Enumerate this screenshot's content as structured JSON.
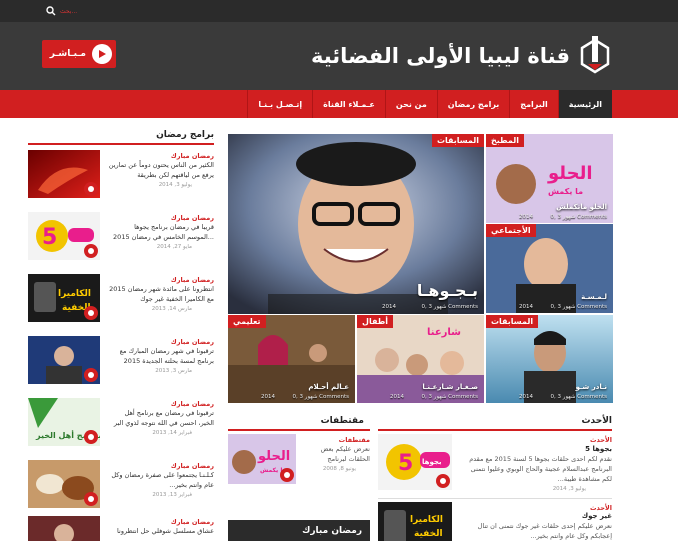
{
  "search": {
    "placeholder": "بحث..."
  },
  "header": {
    "live_label": "مـبـاشـر",
    "logo_text": "قناة ليبيا الأولى الفضائية"
  },
  "nav": {
    "items": [
      "الرئيسية",
      "البرامج",
      "برامج رمضان",
      "من نحن",
      "عـمـلاء القناة",
      "إتـصـل بـنـا"
    ]
  },
  "sidebar": {
    "title": "برامج رمضان",
    "items": [
      {
        "category": "رمضان مبارك",
        "title": "الكثير من الناس  يحتون دوماً عن تمارين يرفع من لياقتهم لكن بطريقة",
        "date": "يوليو 3, 2014"
      },
      {
        "category": "رمضان مبارك",
        "title": "قريبا في رمضان برنامج يجوها ...الموسم الخامس في رمضان 2015",
        "date": "مايو 27, 2014"
      },
      {
        "category": "رمضان مبارك",
        "title": "انتظرونا على مائدة شهر رمضان 2015 مع الكاميرا الخفية غير جوك",
        "date": "مارس 14, 2013"
      },
      {
        "category": "رمضان مبارك",
        "title": "ترقبونا في شهر رمضان المبارك مع برنامج لمسة بحلته الجديدة 2015",
        "date": "مارس 3, 2013"
      },
      {
        "category": "رمضان مبارك",
        "title": "ترقبونا في رمضان مع برنامج أهل الخير، احسن في الله نتوجه لذوي البر",
        "date": "فبراير 14, 2013"
      },
      {
        "category": "رمضان مبارك",
        "title": "كـلـنـا يجتمعوا على صفرة رمضان وكل عام وانتم بخير...",
        "date": "فبراير 13, 2013"
      },
      {
        "category": "رمضان مبارك",
        "title": "عشاق مسلسل شوفلي حل انتظرونا",
        "date": ""
      }
    ]
  },
  "grid": {
    "main": {
      "tag": "المسابقات",
      "caption": "بـجـوهـا",
      "meta": "شهور 3  ,0 Comments",
      "date": "2014"
    },
    "kitchen": {
      "tag": "المطبخ",
      "caption": "الحلو ماتكملش",
      "meta": "شهور 3  ,0 Comments",
      "date": "2014",
      "art_line1": "الحلو",
      "art_line2": "ما يكمش"
    },
    "social": {
      "tag": "الأجتماعي",
      "caption": "لـمـسـة",
      "meta": "شهور 3  ,0 Comments",
      "date": "2014"
    },
    "education": {
      "tag": "تعليمي",
      "caption": "عـالم أحـلام",
      "meta": "شهور 3  ,0 Comments",
      "date": "2014"
    },
    "kids": {
      "tag": "أطفال",
      "caption": "صـغـار شـارعـنـا",
      "meta": "شهور 3  ,0 Comments",
      "date": "2014",
      "art_text": "شارعنا"
    },
    "contests2": {
      "tag": "المسابقات",
      "caption": "نـادر شـو",
      "meta": "شهور 3  ,0 Comments",
      "date": "2014"
    }
  },
  "latest": {
    "title": "الأحدث",
    "items": [
      {
        "category": "الأحدث",
        "title": "بجوها 5",
        "text": "نقدم لكم احدى حلقات بجوها 5 لسنة 2015 مع مقدم البرنامج عبدالسلام عجينة والحاج الوبوي وعليوا نتمنى لكم مشاهدة طيبة...",
        "date": "يوليو 3, 2014",
        "art_text": "بجوها",
        "art_num": "5"
      },
      {
        "category": "الأحدث",
        "title": "غير جوك",
        "text": "نعرض عليكم إحدى حلقات غير جوك نتمنى ان تنال إعجابكم وكل عام وانتم بخير...",
        "date": "",
        "art_line1": "الكاميرا",
        "art_line2": "الخفية"
      }
    ]
  },
  "selections": {
    "title": "مقتطفات",
    "item": {
      "category": "مقتطفات",
      "text": "نعرض عليكم بعض الحلقات لبرنامج",
      "date": "يونيو 8, 2008",
      "art_line1": "الحلو",
      "art_line2": "ما يكمش"
    },
    "ramadan_label": "رمضان مبارك"
  },
  "side_art": {
    "item2_num": "5",
    "item3_line1": "الكاميرا",
    "item3_line2": "الخفية",
    "item5_text": "برنامج أهل الخير"
  },
  "colors": {
    "accent": "#d11f20",
    "dark": "#2b2b2b",
    "header": "#3a3a3a"
  }
}
